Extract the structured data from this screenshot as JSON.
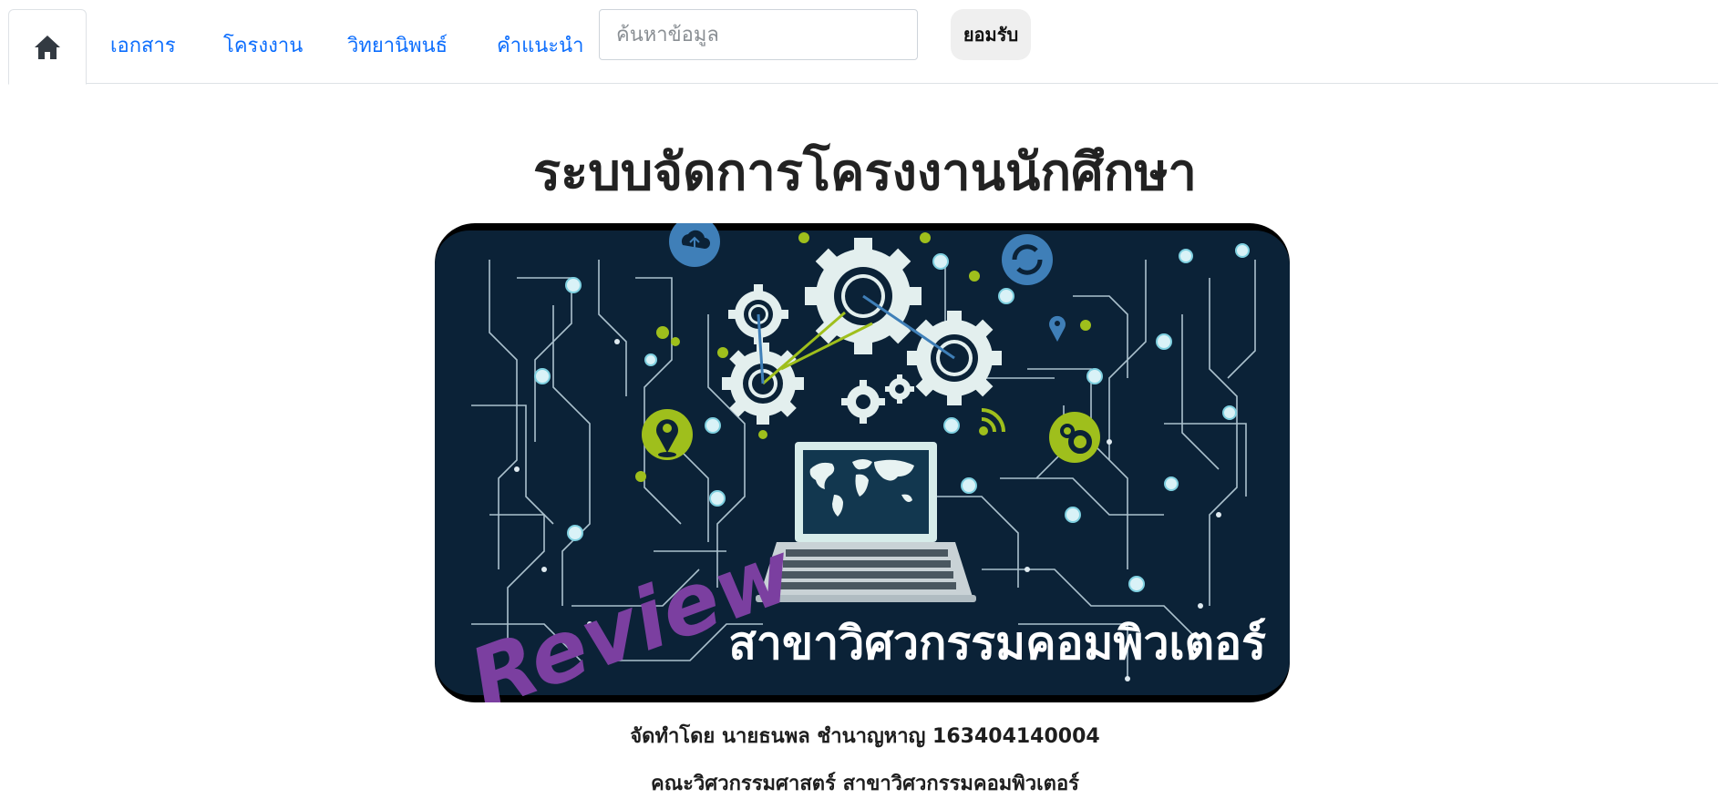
{
  "nav": {
    "home_icon": "home-icon",
    "links": [
      "เอกสาร",
      "โครงงาน",
      "วิทยานิพนธ์",
      "คำแนะนำ"
    ],
    "search_placeholder": "ค้นหาข้อมูล",
    "search_value": "",
    "accept_label": "ยอมรับ"
  },
  "main": {
    "title": "ระบบจัดการโครงงานนักศึกษา",
    "banner": {
      "review_text": "Review",
      "caption": "สาขาวิศวกรรมคอมพิวเตอร์",
      "icons": [
        "cloud-icon",
        "sync-icon",
        "gear-icon",
        "location-pin-icon",
        "wifi-icon",
        "laptop-icon",
        "world-map-icon"
      ]
    },
    "credit_author": "จัดทำโดย นายธนพล ชำนาญหาญ 163404140004",
    "credit_faculty": "คณะวิศวกรรมศาสตร์ สาขาวิศวกรรมคอมพิวเตอร์"
  },
  "colors": {
    "link": "#0d6efd",
    "banner_bg": "#0b2237",
    "circuit": "#c8dde8",
    "lime": "#9fbf1c",
    "review": "#7b3fa0",
    "gear": "#e3efee"
  }
}
